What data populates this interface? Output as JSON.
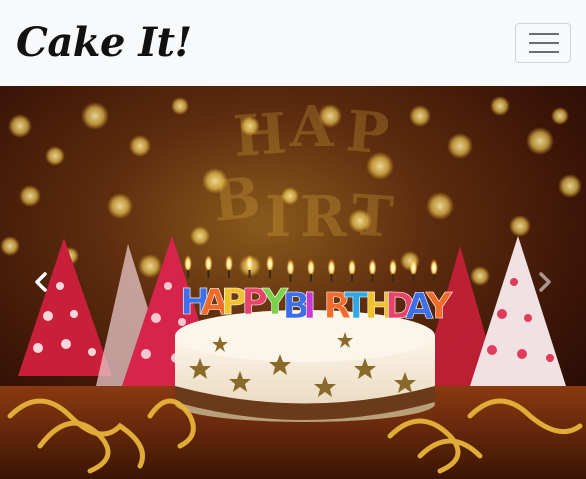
{
  "navbar": {
    "brand": "Cake It!",
    "toggler_icon": "hamburger-menu-icon",
    "background": "#f8f9fa"
  },
  "carousel": {
    "image": {
      "alt": "Birthday cake with candles",
      "cake_topper_letters": [
        "H",
        "A",
        "P",
        "P",
        "Y",
        "B",
        "I",
        "R",
        "T",
        "H",
        "D",
        "A",
        "Y"
      ],
      "cake_topper_colors": [
        "#3d6fe8",
        "#f26b2a",
        "#f1c22c",
        "#e8436a",
        "#7bd24a",
        "#3d6fe8",
        "#c43bd1",
        "#f26b2a",
        "#2fa8e6",
        "#f1c22c",
        "#e8436a",
        "#3d6fe8",
        "#f26b2a"
      ]
    },
    "prev": {
      "icon": "chevron-left-icon",
      "label": "Previous"
    },
    "next": {
      "icon": "chevron-right-icon",
      "label": "Next"
    },
    "colors": {
      "warm_dark": "#2a0d05",
      "gold": "#f5c84a",
      "frosting": "#fbf3e6"
    }
  }
}
